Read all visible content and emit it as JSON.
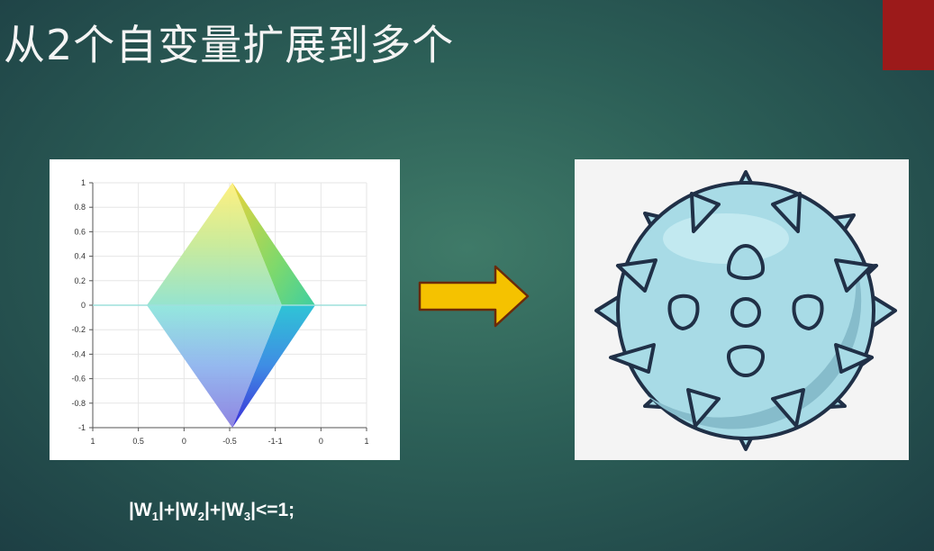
{
  "slide": {
    "title": "从2个自变量扩展到多个",
    "formula": {
      "parts": [
        "|W",
        "1",
        "|+|W",
        "2",
        "|+|W",
        "3",
        "|<=1;"
      ]
    }
  },
  "chart_data": {
    "type": "3d-surface",
    "y_tick_labels": [
      "1",
      "0.8",
      "0.6",
      "0.4",
      "0.2",
      "0",
      "-0.2",
      "-0.4",
      "-0.6",
      "-0.8",
      "-1"
    ],
    "x_tick_labels": [
      "1",
      "0.5",
      "0",
      "-0.5",
      "-1-1",
      "0",
      "1"
    ]
  },
  "colors": {
    "arrow_fill": "#f5c200",
    "arrow_stroke": "#6b2a0a",
    "ball_fill": "#a8dbe6",
    "outline": "#203047",
    "corner_accent": "#9c1a1a"
  },
  "icons": {
    "arrow": "right-arrow-icon",
    "ball": "spiked-ball-icon"
  }
}
